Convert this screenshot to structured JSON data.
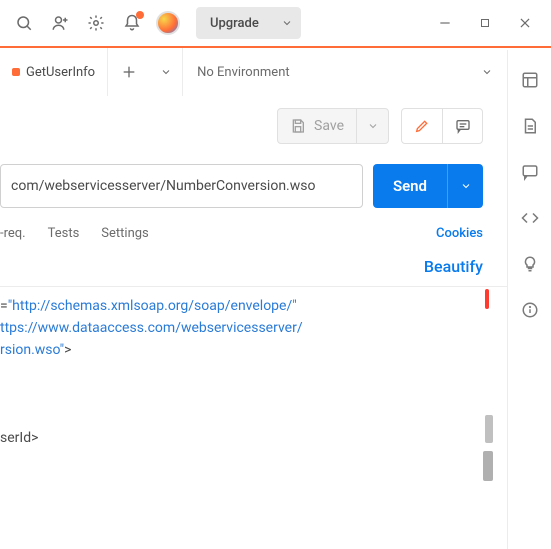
{
  "topbar": {
    "upgrade_label": "Upgrade"
  },
  "tabs": {
    "active": "GetUserInfo"
  },
  "env": {
    "selected": "No Environment"
  },
  "toolbar": {
    "save_label": "Save"
  },
  "request": {
    "url": "com/webservicesserver/NumberConversion.wso",
    "send_label": "Send"
  },
  "subtabs": {
    "prereq": "-req.",
    "tests": "Tests",
    "settings": "Settings",
    "cookies": "Cookies",
    "beautify": "Beautify"
  },
  "editor": {
    "l1_attr": "=",
    "l1_str": "\"http://schemas.xmlsoap.org/soap/envelope/\"",
    "l2_str": "ttps://www.dataaccess.com/webservicesserver/",
    "l3_str": "rsion.wso\"",
    "l3_tag": ">",
    "l4_tag": "serId>"
  }
}
